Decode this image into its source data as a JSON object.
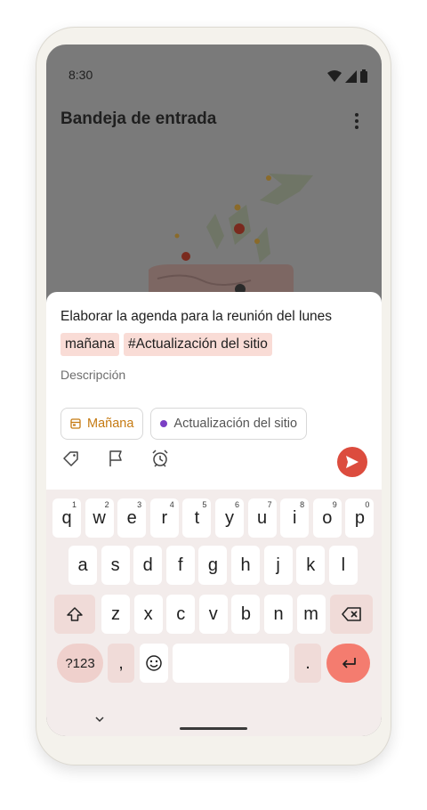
{
  "status_bar": {
    "time": "8:30"
  },
  "app_bar": {
    "title": "Bandeja de entrada"
  },
  "task": {
    "title": "Elaborar la agenda para la reunión del lunes",
    "highlight_date": "mañana",
    "highlight_project": "#Actualización del sitio",
    "description_placeholder": "Descripción",
    "date_chip": "Mañana",
    "project_chip": "Actualización del sitio"
  },
  "keyboard": {
    "row1": [
      {
        "k": "q",
        "n": "1"
      },
      {
        "k": "w",
        "n": "2"
      },
      {
        "k": "e",
        "n": "3"
      },
      {
        "k": "r",
        "n": "4"
      },
      {
        "k": "t",
        "n": "5"
      },
      {
        "k": "y",
        "n": "6"
      },
      {
        "k": "u",
        "n": "7"
      },
      {
        "k": "i",
        "n": "8"
      },
      {
        "k": "o",
        "n": "9"
      },
      {
        "k": "p",
        "n": "0"
      }
    ],
    "row2": [
      "a",
      "s",
      "d",
      "f",
      "g",
      "h",
      "j",
      "k",
      "l"
    ],
    "row3": [
      "z",
      "x",
      "c",
      "v",
      "b",
      "n",
      "m"
    ],
    "symbols": "?123",
    "comma": ",",
    "period": "."
  },
  "colors": {
    "accent": "#dc4c3e",
    "date": "#c57a12",
    "project_dot": "#7b3fc4",
    "highlight": "#f9dcd6",
    "enter_key": "#f47c6f"
  }
}
